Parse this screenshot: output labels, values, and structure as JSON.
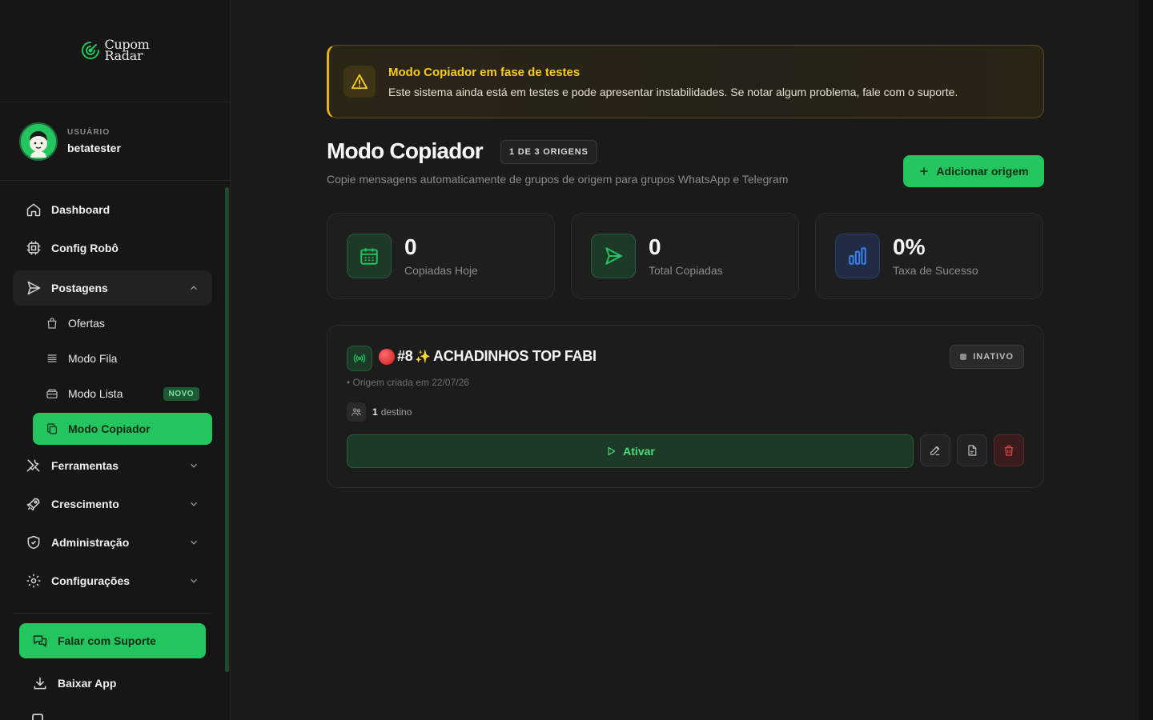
{
  "brand": {
    "line1": "Cupom",
    "line2": "Radar"
  },
  "user": {
    "label": "USUÁRIO",
    "name": "betatester"
  },
  "nav": {
    "dashboard": "Dashboard",
    "config_robo": "Config Robô",
    "postagens": "Postagens",
    "sub": {
      "ofertas": "Ofertas",
      "modo_fila": "Modo Fila",
      "modo_lista": "Modo Lista",
      "modo_lista_badge": "NOVO",
      "modo_copiador": "Modo Copiador"
    },
    "ferramentas": "Ferramentas",
    "crescimento": "Crescimento",
    "administracao": "Administração",
    "configuracoes": "Configurações",
    "support": "Falar com Suporte",
    "download_app": "Baixar App"
  },
  "banner": {
    "title": "Modo Copiador em fase de testes",
    "text": "Este sistema ainda está em testes e pode apresentar instabilidades. Se notar algum problema, fale com o suporte."
  },
  "page": {
    "title": "Modo Copiador",
    "origins_badge": "1 DE 3 ORIGENS",
    "subtitle": "Copie mensagens automaticamente de grupos de origem para grupos WhatsApp e Telegram",
    "add_button": "Adicionar origem"
  },
  "stats": [
    {
      "value": "0",
      "label": "Copiadas Hoje",
      "icon": "calendar-icon"
    },
    {
      "value": "0",
      "label": "Total Copiadas",
      "icon": "send-icon"
    },
    {
      "value": "0%",
      "label": "Taxa de Sucesso",
      "icon": "bar-chart-icon"
    }
  ],
  "origin_card": {
    "title_prefix": "#8",
    "title_name": "ACHADINHOS TOP FABI",
    "status": "INATIVO",
    "created": "Origem criada em 22/07/26",
    "dest_count": "1",
    "dest_label": "destino",
    "activate_label": "Ativar"
  },
  "colors": {
    "accent": "#22c55e",
    "warning": "#facc15",
    "background": "#1a1a1a",
    "danger": "#ef4444",
    "info": "#3b82f6"
  }
}
